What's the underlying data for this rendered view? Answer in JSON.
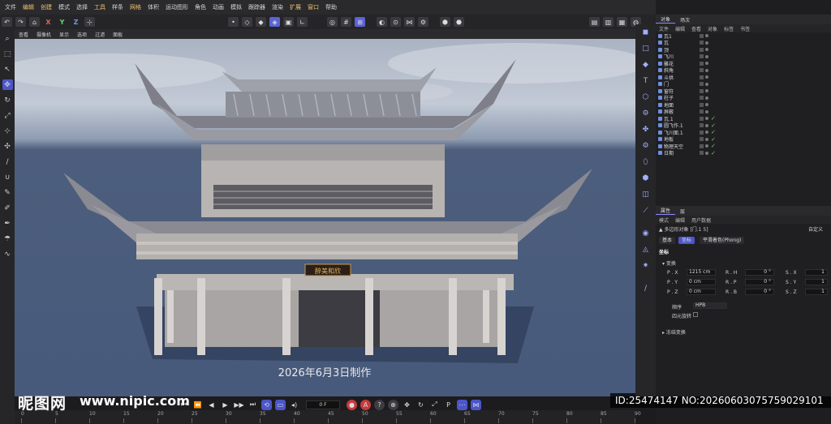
{
  "menubar": {
    "items": [
      "文件",
      "编辑",
      "创建",
      "模式",
      "选择",
      "工具",
      "样条",
      "网格",
      "体积",
      "运动图形",
      "角色",
      "动画",
      "模拟",
      "跟踪器",
      "渲染",
      "扩展",
      "窗口",
      "帮助"
    ]
  },
  "toolbar": {
    "axes": [
      "X",
      "Y",
      "Z"
    ]
  },
  "viewport_menu": {
    "items": [
      "查看",
      "摄像机",
      "显示",
      "选项",
      "过滤",
      "面板"
    ]
  },
  "viewport": {
    "caption": "2026年6月3日制作",
    "plaque": "醉美和欣"
  },
  "timeline": {
    "frame": "0 F",
    "ticks": [
      "0",
      "5",
      "10",
      "15",
      "20",
      "25",
      "30",
      "35",
      "40",
      "45",
      "50",
      "55",
      "60",
      "65",
      "70",
      "75",
      "80",
      "85",
      "90"
    ]
  },
  "watermark": {
    "logo": "昵图网",
    "url": "www.nipic.com",
    "id_text": "ID:25474147 NO:20260603075759029101"
  },
  "object_manager": {
    "tabs": [
      "对象",
      "场次"
    ],
    "menu": [
      "文件",
      "编辑",
      "查看",
      "对象",
      "标签",
      "书签"
    ],
    "objects": [
      {
        "name": "瓦1"
      },
      {
        "name": "瓦"
      },
      {
        "name": "顶"
      },
      {
        "name": "飞川"
      },
      {
        "name": "雕花"
      },
      {
        "name": "斜角"
      },
      {
        "name": "斗拱"
      },
      {
        "name": "门"
      },
      {
        "name": "窗符"
      },
      {
        "name": "柱子"
      },
      {
        "name": "地面"
      },
      {
        "name": "屏蔽"
      },
      {
        "name": "瓦.1"
      },
      {
        "name": "圆飞作.1"
      },
      {
        "name": "飞川面.1"
      },
      {
        "name": "地板"
      },
      {
        "name": "物理天空"
      },
      {
        "name": "日期"
      }
    ]
  },
  "attributes": {
    "tabs": [
      "属性",
      "层"
    ],
    "menu": [
      "模式",
      "编辑",
      "用户数据"
    ],
    "object_label": "多边形对象 [门.1 5]",
    "custom_label": "自定义",
    "subtabs": [
      "基本",
      "坐标",
      "平滑着色(Phong)"
    ],
    "section": "坐标",
    "group": "变换",
    "pos": [
      {
        "label": "P . X",
        "value": "1215 cm"
      },
      {
        "label": "P . Y",
        "value": "0 cm"
      },
      {
        "label": "P . Z",
        "value": "0 cm"
      }
    ],
    "rot": [
      {
        "label": "R . H",
        "value": "0 °"
      },
      {
        "label": "R . P",
        "value": "0 °"
      },
      {
        "label": "R . B",
        "value": "0 °"
      }
    ],
    "scale": [
      {
        "label": "S . X",
        "value": "1"
      },
      {
        "label": "S . Y",
        "value": "1"
      },
      {
        "label": "S . Z",
        "value": "1"
      }
    ],
    "order_label": "顺序",
    "order_value": "HPB",
    "quaternion_label": "四元旋转",
    "freeze_label": "冻结变换"
  }
}
